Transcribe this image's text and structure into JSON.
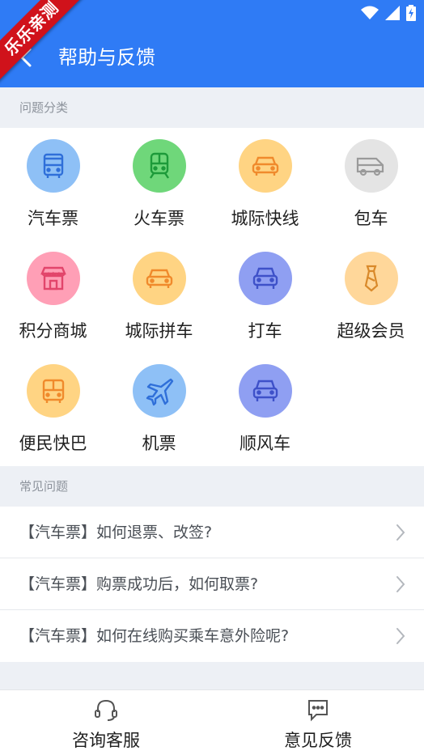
{
  "ribbon": "乐乐亲测",
  "header": {
    "title": "帮助与反馈"
  },
  "sections": {
    "categories_label": "问题分类",
    "faq_label": "常见问题"
  },
  "categories": [
    {
      "label": "汽车票",
      "icon": "bus-icon",
      "bg": "#8ec0f6"
    },
    {
      "label": "火车票",
      "icon": "train-icon",
      "bg": "#6fd77a"
    },
    {
      "label": "城际快线",
      "icon": "car-icon",
      "bg": "#ffd483"
    },
    {
      "label": "包车",
      "icon": "van-icon",
      "bg": "#e4e4e4"
    },
    {
      "label": "积分商城",
      "icon": "shop-icon",
      "bg": "#ff9fb6"
    },
    {
      "label": "城际拼车",
      "icon": "carpool-icon",
      "bg": "#ffd483"
    },
    {
      "label": "打车",
      "icon": "taxi-icon",
      "bg": "#8f9ff2"
    },
    {
      "label": "超级会员",
      "icon": "tie-icon",
      "bg": "#ffd79a"
    },
    {
      "label": "便民快巴",
      "icon": "minibus-icon",
      "bg": "#ffd483"
    },
    {
      "label": "机票",
      "icon": "plane-icon",
      "bg": "#8ec0f6"
    },
    {
      "label": "顺风车",
      "icon": "rideshare-icon",
      "bg": "#8f9ff2"
    }
  ],
  "faqs": [
    "【汽车票】如何退票、改签?",
    "【汽车票】购票成功后，如何取票?",
    "【汽车票】如何在线购买乘车意外险呢?"
  ],
  "bottom": {
    "service_label": "咨询客服",
    "feedback_label": "意见反馈"
  }
}
